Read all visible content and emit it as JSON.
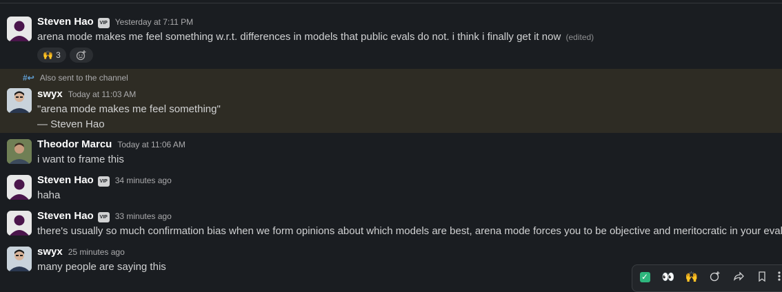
{
  "messages": [
    {
      "author": "Steven Hao",
      "vip": "VIP",
      "time": "Yesterday at 7:11 PM",
      "text": "arena mode makes me feel something w.r.t. differences in models that public evals do not. i think i finally get it now",
      "edited": "(edited)",
      "reaction_emoji": "🙌",
      "reaction_count": "3"
    },
    {
      "also_sent": "Also sent to the channel",
      "author": "swyx",
      "time": "Today at 11:03 AM",
      "text_line1": "\"arena mode makes me feel something\"",
      "text_line2": "— Steven Hao"
    },
    {
      "author": "Theodor Marcu",
      "time": "Today at 11:06 AM",
      "text": "i want to frame this"
    },
    {
      "author": "Steven Hao",
      "vip": "VIP",
      "time": "34 minutes ago",
      "text": "haha"
    },
    {
      "author": "Steven Hao",
      "vip": "VIP",
      "time": "33 minutes ago",
      "text": "there's usually so much confirmation bias when we form opinions about which models are best, arena mode forces you to be objective and meritocratic in your eval"
    },
    {
      "author": "swyx",
      "time": "25 minutes ago",
      "text": "many people are saying this"
    }
  ],
  "toolbar": {
    "check": "✓",
    "eyes": "👀",
    "raised_hands": "🙌"
  }
}
